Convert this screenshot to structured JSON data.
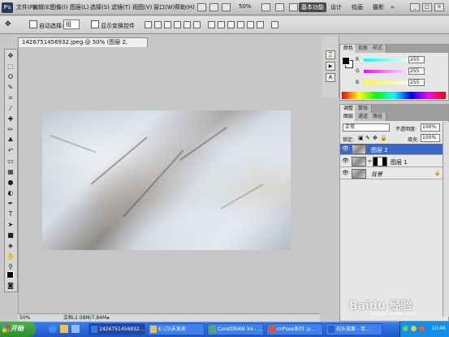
{
  "menubar": {
    "logo": "Ps",
    "items": [
      "文件(F)",
      "编辑(E)",
      "图像(I)",
      "图层(L)",
      "选择(S)",
      "滤镜(T)",
      "视图(V)",
      "窗口(W)",
      "帮助(H)"
    ],
    "zoom": "50%",
    "workspaces": [
      "基本功能",
      "设计",
      "绘画",
      "摄影"
    ],
    "active_workspace": "基本功能",
    "more": "»"
  },
  "options": {
    "auto_select_label": "自动选择:",
    "auto_select_value": "组",
    "show_transform_label": "显示变换控件"
  },
  "document": {
    "tab_title": "1426751456932.jpeg @ 50% (图层 2, RGB/8#) *",
    "close": "×"
  },
  "status": {
    "zoom": "50%",
    "doc_info": "文档:2.08M/7.84M"
  },
  "color_panel": {
    "tabs": [
      "颜色",
      "色板",
      "样式"
    ],
    "channels": [
      {
        "label": "R",
        "value": "255",
        "color": "#e04040"
      },
      {
        "label": "G",
        "value": "255",
        "color": "#40c040"
      },
      {
        "label": "B",
        "value": "255",
        "color": "#4060e0"
      }
    ]
  },
  "adjust_tabs": [
    "调整",
    "蒙版"
  ],
  "layers_panel": {
    "tabs": [
      "图层",
      "通道",
      "路径"
    ],
    "blend_mode": "正常",
    "opacity_label": "不透明度:",
    "opacity": "100%",
    "lock_label": "锁定:",
    "fill_label": "填充:",
    "fill": "100%",
    "layers": [
      {
        "name": "图层 2",
        "selected": true,
        "mask": false
      },
      {
        "name": "图层 1",
        "selected": false,
        "mask": true
      },
      {
        "name": "背景",
        "selected": false,
        "mask": false
      }
    ]
  },
  "taskbar": {
    "start": "开始",
    "buttons": [
      {
        "label": "1426751456932...",
        "icon": "#2b7de0"
      },
      {
        "label": "E:\\刀\\未发表",
        "icon": "#f0c040"
      },
      {
        "label": "CorelDRAW X4 - ...",
        "icon": "#50b050"
      },
      {
        "label": "cnPsee系列 -p...",
        "icon": "#e05030"
      },
      {
        "label": "石头效果 - 百...",
        "icon": "#2a5ec8"
      }
    ],
    "clock": "10:46"
  },
  "watermark": {
    "main": "Baidu 经验",
    "sub": "jingyan.baidu.com"
  }
}
